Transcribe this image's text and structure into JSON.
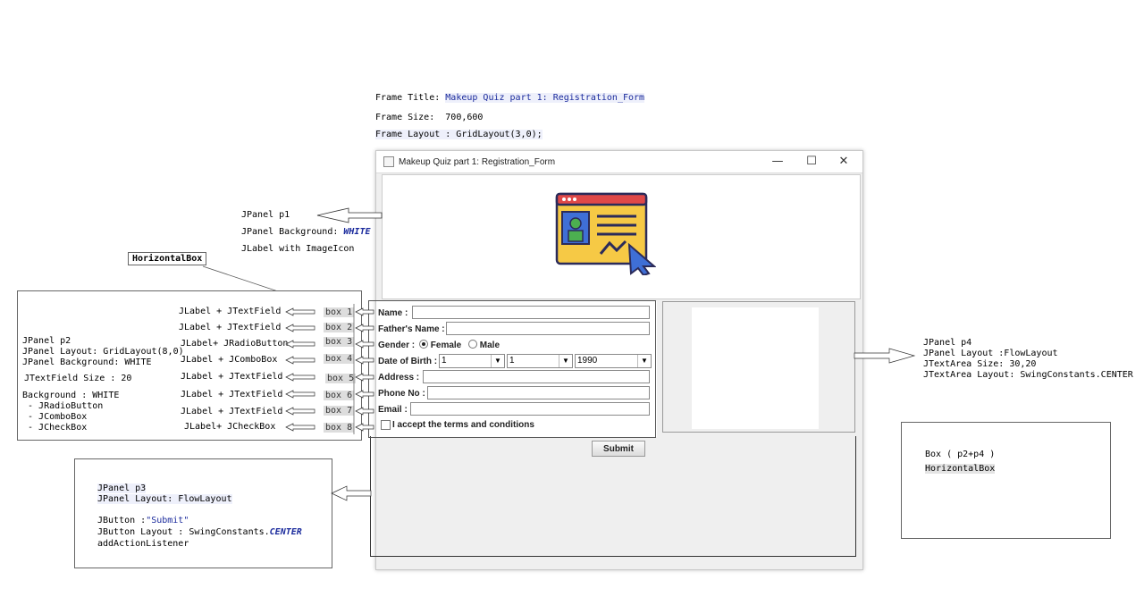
{
  "frame_specs": {
    "title_label": "Frame Title:",
    "title_value": "Makeup Quiz part 1: Registration_Form",
    "size_label": "Frame Size:",
    "size_value": "700,600",
    "layout_line": "Frame Layout : GridLayout(3,0);"
  },
  "window": {
    "title": "Makeup Quiz part 1: Registration_Form",
    "minimize": "—",
    "maximize": "☐",
    "close": "✕"
  },
  "p1_note": {
    "line1": "JPanel p1",
    "line2_prefix": "JPanel Background: ",
    "line2_value": "WHITE",
    "line3": "JLabel with ImageIcon"
  },
  "horizontal_box_tag": "HorizontalBox",
  "p2_note": {
    "lines": [
      "JPanel p2",
      "JPanel Layout: GridLayout(8,0)",
      "JPanel Background: WHITE",
      "JTextField Size : 20",
      "Background : WHITE",
      " - JRadioButton",
      " - JComboBox",
      " - JCheckBox"
    ],
    "rows": [
      {
        "desc": "JLabel + JTextField",
        "box": "box 1"
      },
      {
        "desc": "JLabel + JTextField",
        "box": "box 2"
      },
      {
        "desc": "JLabel+ JRadioButton",
        "box": "box 3"
      },
      {
        "desc": "JLabel + JComboBox",
        "box": "box 4"
      },
      {
        "desc": "JLabel + JTextField",
        "box": "box 5"
      },
      {
        "desc": "JLabel + JTextField",
        "box": "box 6"
      },
      {
        "desc": "JLabel + JTextField",
        "box": "box 7"
      },
      {
        "desc": "JLabel+ JCheckBox",
        "box": "box 8"
      }
    ]
  },
  "form": {
    "name_label": "Name :",
    "father_label": "Father's Name :",
    "gender_label": "Gender :",
    "gender_female": "Female",
    "gender_male": "Male",
    "dob_label": "Date of Birth :",
    "dob_day": "1",
    "dob_month": "1",
    "dob_year": "1990",
    "address_label": "Address :",
    "phone_label": "Phone No :",
    "email_label": "Email :",
    "terms_label": "I accept the terms and conditions",
    "submit_label": "Submit"
  },
  "p3_note": {
    "line1": "JPanel p3",
    "line2": "JPanel Layout: FlowLayout",
    "line3_prefix": "JButton :",
    "line3_value": "\"Submit\"",
    "line4_prefix": "JButton Layout : SwingConstants.",
    "line4_value": "CENTER",
    "line5": "addActionListener"
  },
  "p4_note": {
    "line1": "JPanel p4",
    "line2": "JPanel Layout :FlowLayout",
    "line3": "JTextArea Size: 30,20",
    "line4": "JTextArea Layout: SwingConstants.CENTER"
  },
  "box_note": {
    "line1": "Box ( p2+p4 )",
    "line2": "HorizontalBox"
  },
  "colors": {
    "code_blue": "#1a2a9c",
    "highlight": "#eef0fb",
    "icon_red": "#e04848",
    "icon_yellow": "#f6c945",
    "icon_blue": "#3f6fd6"
  }
}
